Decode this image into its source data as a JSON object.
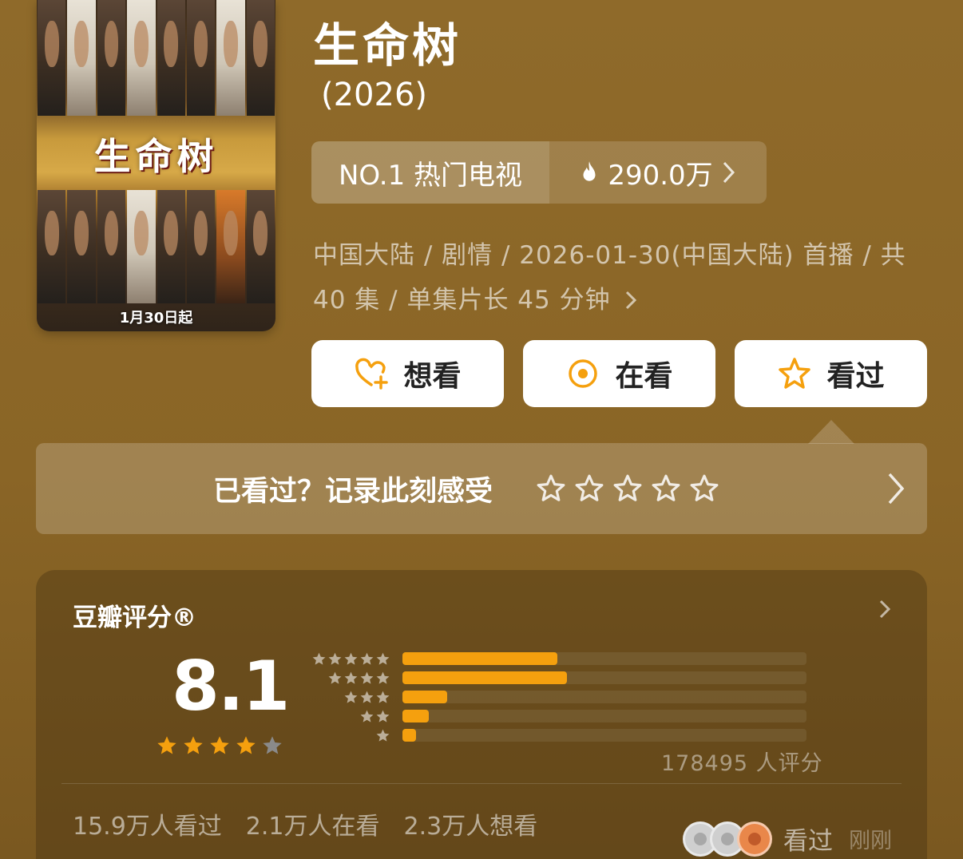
{
  "poster": {
    "title_art": "生命树",
    "air_date": "1月30日起"
  },
  "header": {
    "title": "生命树",
    "year": "(2026)"
  },
  "ranking": {
    "rank_label": "NO.1 热门电视",
    "heat": "290.0万"
  },
  "meta": {
    "info_line": "中国大陆 / 剧情 / 2026-01-30(中国大陆) 首播 / 共 40 集 / 单集片长 45 分钟"
  },
  "actions": {
    "want_label": "想看",
    "watching_label": "在看",
    "watched_label": "看过"
  },
  "prompt": {
    "text": "已看过？记录此刻感受",
    "stars": 5
  },
  "rating": {
    "title": "豆瓣评分®",
    "score": "8.1",
    "star_rating": 4,
    "star_max": 5,
    "distribution": [
      {
        "stars": 5,
        "fraction": 0.383
      },
      {
        "stars": 4,
        "fraction": 0.407
      },
      {
        "stars": 3,
        "fraction": 0.111
      },
      {
        "stars": 2,
        "fraction": 0.065
      },
      {
        "stars": 1,
        "fraction": 0.034
      }
    ],
    "count_text": "178495 人评分",
    "stats": {
      "watched": "15.9万人看过",
      "watching": "2.1万人在看",
      "want": "2.3万人想看"
    },
    "recent": {
      "label": "看过",
      "time": "刚刚"
    }
  },
  "colors": {
    "accent": "#f5a00e",
    "background": "#8d6828",
    "star_empty": "#8a8a8a"
  },
  "icons": [
    "heart-plus-icon",
    "target-icon",
    "star-outline-icon",
    "flame-icon",
    "chevron-right-icon"
  ]
}
